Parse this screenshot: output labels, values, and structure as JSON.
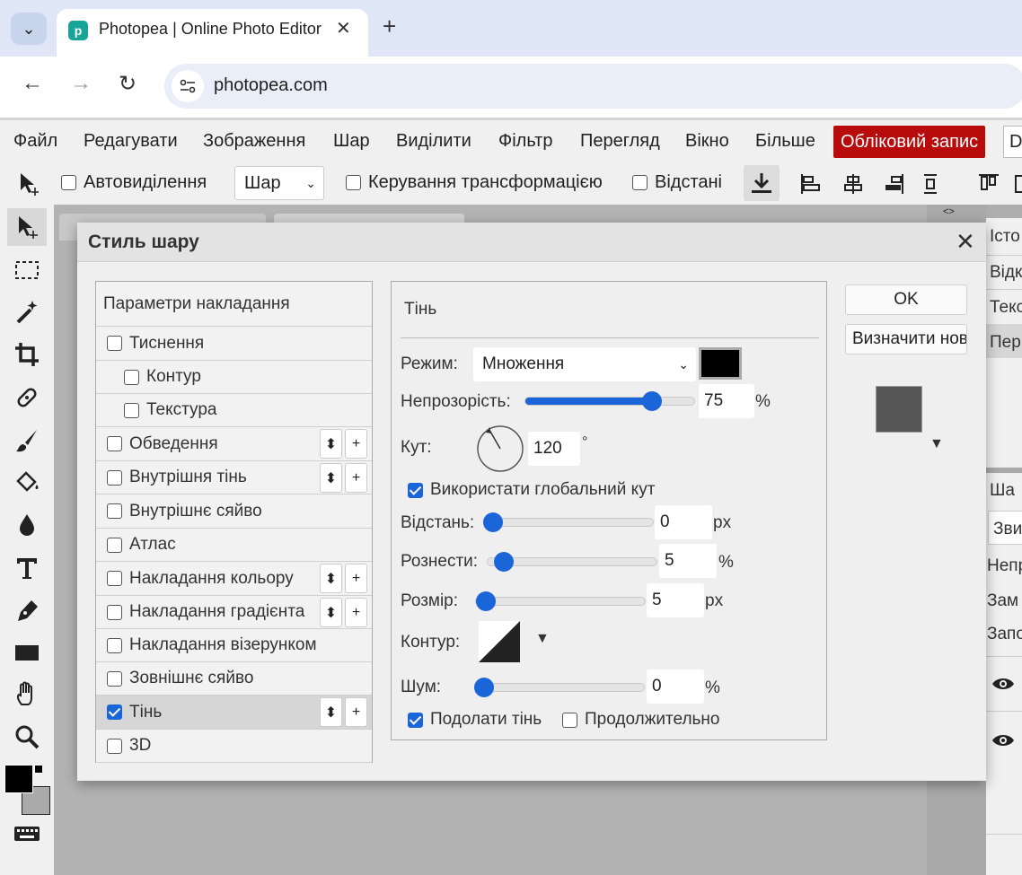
{
  "browser": {
    "tab_title": "Photopea | Online Photo Editor",
    "url": "photopea.com"
  },
  "menu": {
    "items": [
      "Файл",
      "Редагувати",
      "Зображення",
      "Шар",
      "Виділити",
      "Фільтр",
      "Перегляд",
      "Вікно",
      "Більше"
    ],
    "account": "Обліковий запис",
    "lang": "De"
  },
  "options": {
    "auto_select": "Автовиділення",
    "layer_select": "Шар",
    "transform": "Керування трансформацією",
    "distances": "Відстані"
  },
  "right_panel": {
    "top_items": [
      "Істо",
      "Відк",
      "Текс",
      "Пер"
    ],
    "layers_title": "Ша",
    "blend": "Зви",
    "opacity": "Непр",
    "lock": "Зам",
    "fill": "Запо"
  },
  "dialog": {
    "title": "Стиль шару",
    "effects": [
      {
        "label": "Параметри накладання",
        "checkbox": false,
        "indent": false,
        "checked": false,
        "controls": false,
        "selected": false
      },
      {
        "label": "Тиснення",
        "checkbox": true,
        "indent": false,
        "checked": false,
        "controls": false,
        "selected": false
      },
      {
        "label": "Контур",
        "checkbox": true,
        "indent": true,
        "checked": false,
        "controls": false,
        "selected": false
      },
      {
        "label": "Текстура",
        "checkbox": true,
        "indent": true,
        "checked": false,
        "controls": false,
        "selected": false
      },
      {
        "label": "Обведення",
        "checkbox": true,
        "indent": false,
        "checked": false,
        "controls": true,
        "selected": false
      },
      {
        "label": "Внутрішня тінь",
        "checkbox": true,
        "indent": false,
        "checked": false,
        "controls": true,
        "selected": false
      },
      {
        "label": "Внутрішнє сяйво",
        "checkbox": true,
        "indent": false,
        "checked": false,
        "controls": false,
        "selected": false
      },
      {
        "label": "Атлас",
        "checkbox": true,
        "indent": false,
        "checked": false,
        "controls": false,
        "selected": false
      },
      {
        "label": "Накладання кольору",
        "checkbox": true,
        "indent": false,
        "checked": false,
        "controls": true,
        "selected": false
      },
      {
        "label": "Накладання градієнта",
        "checkbox": true,
        "indent": false,
        "checked": false,
        "controls": true,
        "selected": false
      },
      {
        "label": "Накладання візерунком",
        "checkbox": true,
        "indent": false,
        "checked": false,
        "controls": false,
        "selected": false
      },
      {
        "label": "Зовнішнє сяйво",
        "checkbox": true,
        "indent": false,
        "checked": false,
        "controls": false,
        "selected": false
      },
      {
        "label": "Тінь",
        "checkbox": true,
        "indent": false,
        "checked": true,
        "controls": true,
        "selected": true
      },
      {
        "label": "3D",
        "checkbox": true,
        "indent": false,
        "checked": false,
        "controls": false,
        "selected": false
      }
    ],
    "reorder_glyph": "⬍",
    "add_glyph": "+",
    "panel": {
      "title": "Тінь",
      "mode_label": "Режим:",
      "mode_value": "Множення",
      "shadow_color": "#000000",
      "opacity_label": "Непрозорість:",
      "opacity_value": "75",
      "opacity_unit": "%",
      "opacity_fraction": 0.75,
      "angle_label": "Кут:",
      "angle_value": "120",
      "angle_unit": "°",
      "global_angle_label": "Використати глобальний кут",
      "distance_label": "Відстань:",
      "distance_value": "0",
      "distance_unit": "px",
      "spread_label": "Рознести:",
      "spread_value": "5",
      "spread_unit": "%",
      "size_label": "Розмір:",
      "size_value": "5",
      "size_unit": "px",
      "contour_label": "Контур:",
      "noise_label": "Шум:",
      "noise_value": "0",
      "noise_unit": "%",
      "knockout_label": "Подолати тінь",
      "continuous_label": "Продолжительно"
    },
    "ok": "OK",
    "define": "Визначити нові"
  },
  "colors": {
    "accent": "#1a66d9",
    "account_red": "#b80c0c",
    "preview": "#555555"
  }
}
